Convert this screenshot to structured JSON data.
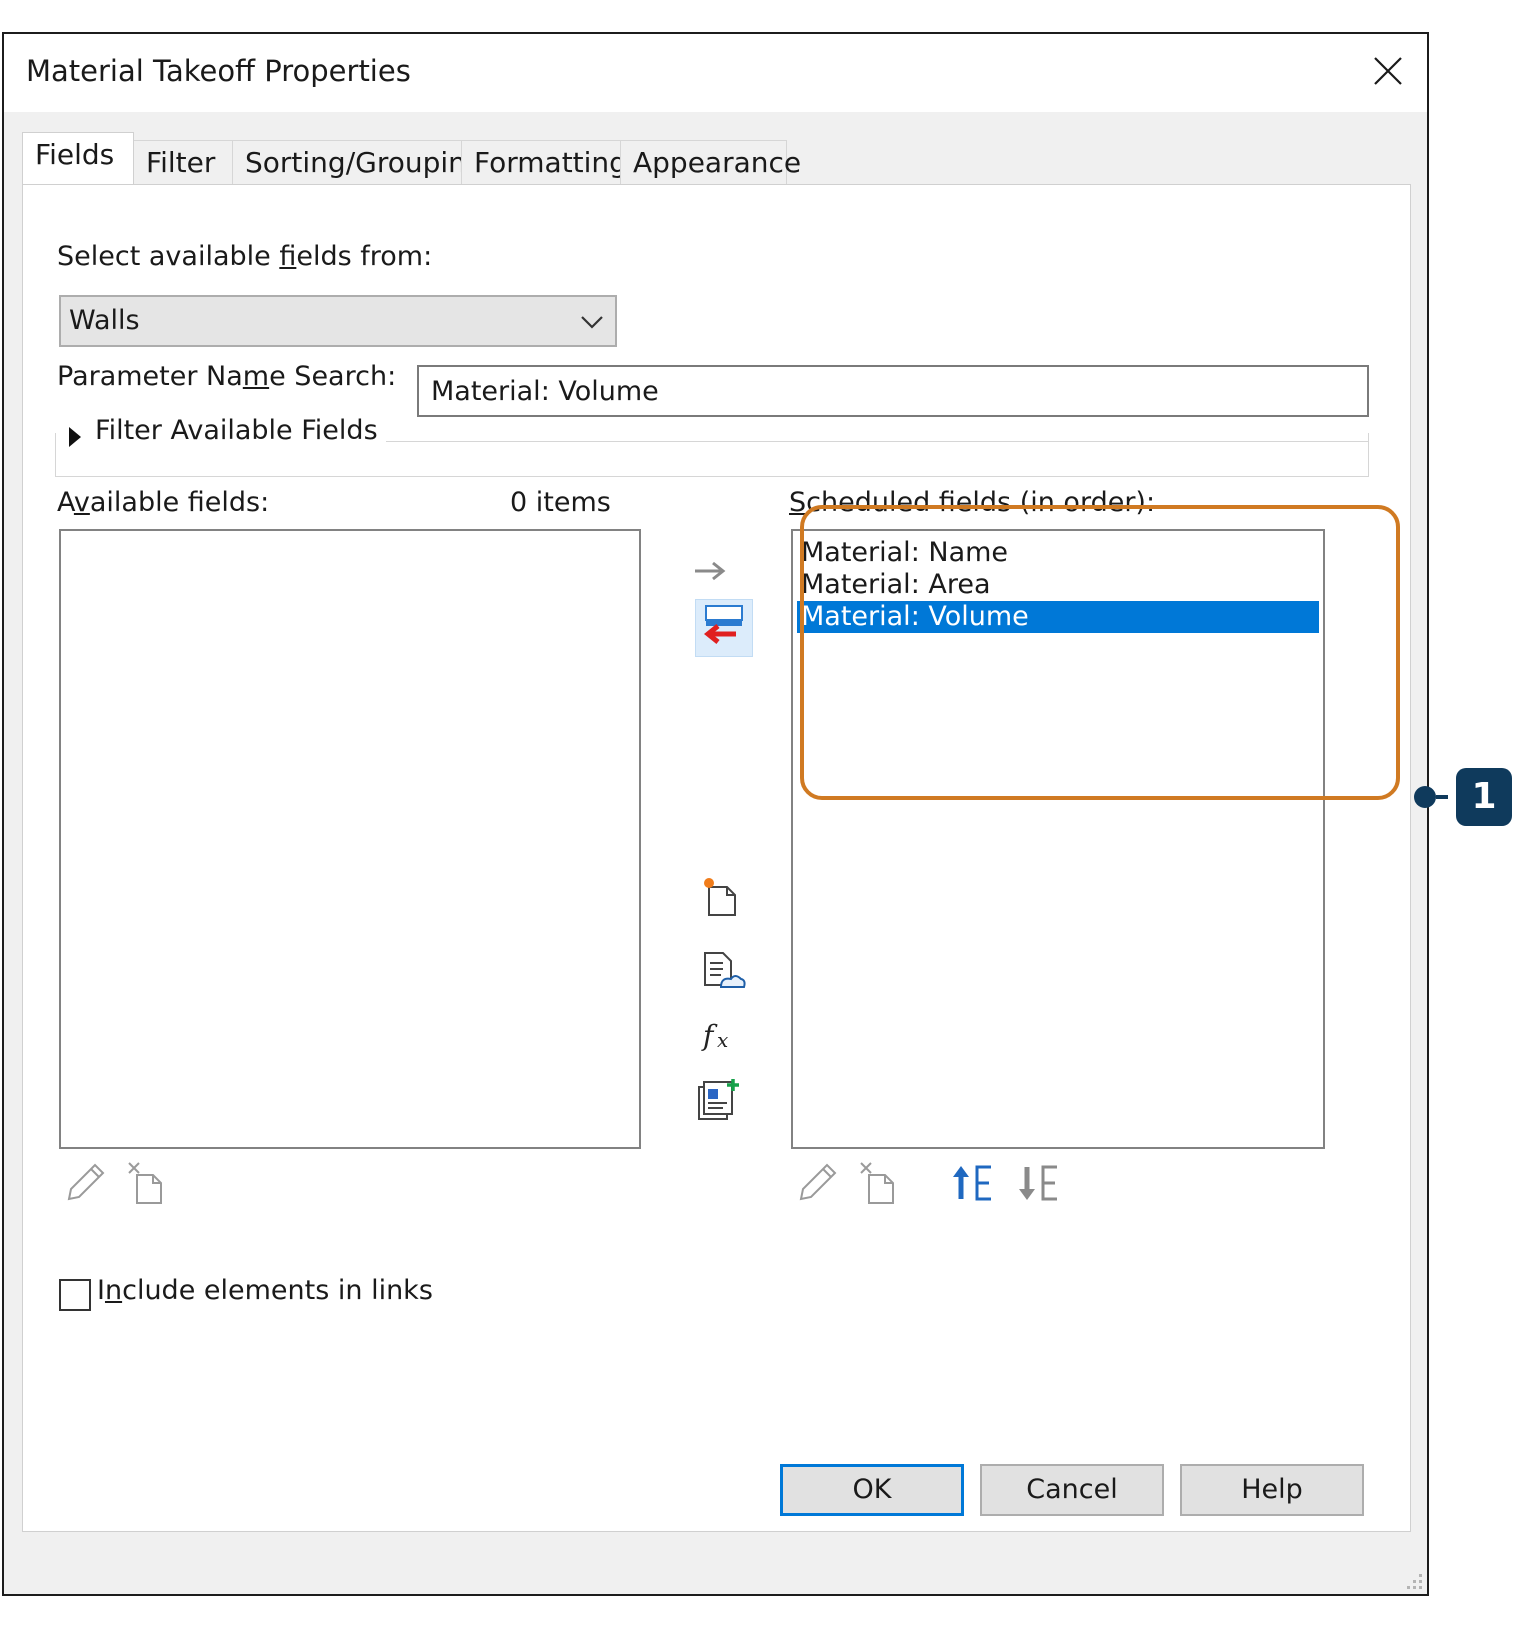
{
  "dialog": {
    "title": "Material Takeoff Properties"
  },
  "tabs": [
    {
      "label": "Fields"
    },
    {
      "label": "Filter"
    },
    {
      "label": "Sorting/Grouping"
    },
    {
      "label": "Formatting"
    },
    {
      "label": "Appearance"
    }
  ],
  "fields_tab": {
    "select_from_label_pre": "Select available ",
    "select_from_label_u": "f",
    "select_from_label_post": "ields from:",
    "select_from_value": "Walls",
    "param_search_label_pre": "Parameter Na",
    "param_search_label_u": "m",
    "param_search_label_post": "e Search:",
    "param_search_value": "Material: Volume",
    "filter_available_label": "Filter Available Fields",
    "available_label_pre": "A",
    "available_label_u": "v",
    "available_label_post": "ailable fields:",
    "available_count": "0 items",
    "scheduled_label_u": "S",
    "scheduled_label_post": "cheduled fields (in order):",
    "scheduled_fields": [
      {
        "label": "Material: Name",
        "selected": false
      },
      {
        "label": "Material: Area",
        "selected": false
      },
      {
        "label": "Material: Volume",
        "selected": true
      }
    ],
    "include_links_pre": "I",
    "include_links_u": "n",
    "include_links_post": "clude elements in links",
    "include_links_checked": false
  },
  "buttons": {
    "ok": "OK",
    "cancel": "Cancel",
    "help": "Help"
  },
  "annotation": {
    "badge": "1",
    "color": "#d07a22",
    "badge_color": "#0f3a5c"
  },
  "colors": {
    "selection": "#0078d7"
  }
}
